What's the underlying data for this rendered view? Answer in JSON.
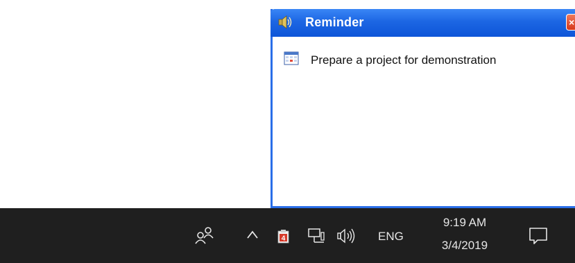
{
  "reminder": {
    "title": "Reminder",
    "close_label": "×",
    "task_text": "Prepare a project for demonstration",
    "title_icon": "speaker-icon",
    "task_icon": "calendar-icon"
  },
  "taskbar": {
    "icons": [
      "people-icon",
      "chevron-up-icon",
      "app-tray-icon",
      "network-icon",
      "volume-icon",
      "notification-icon"
    ],
    "app_badge": "4",
    "language": "ENG",
    "time": "9:19 AM",
    "date": "3/4/2019"
  },
  "colors": {
    "titlebar": "#1c66e3",
    "window_border": "#2a6ee8",
    "close_button": "#d6371a",
    "taskbar": "#1f1f1f",
    "taskbar_text": "#e6e6e6"
  }
}
